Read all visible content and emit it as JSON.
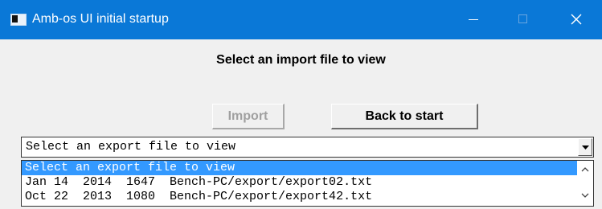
{
  "window": {
    "title": "Amb-os UI initial startup",
    "icon": "app-window-icon",
    "controls": [
      "minimize-icon",
      "maximize-icon",
      "close-icon"
    ],
    "accent_color": "#0a78d7"
  },
  "main": {
    "heading": "Select an import file to view",
    "import_label": "Import",
    "back_label": "Back to start"
  },
  "combo": {
    "selected": "Select an export file to view",
    "dropdown_icon": "chevron-down-icon",
    "items": [
      "Select an export file to view",
      "Jan 14  2014  1647  Bench-PC/export/export02.txt",
      "Oct 22  2013  1080  Bench-PC/export/export42.txt"
    ],
    "selection_color": "#3399ff"
  }
}
